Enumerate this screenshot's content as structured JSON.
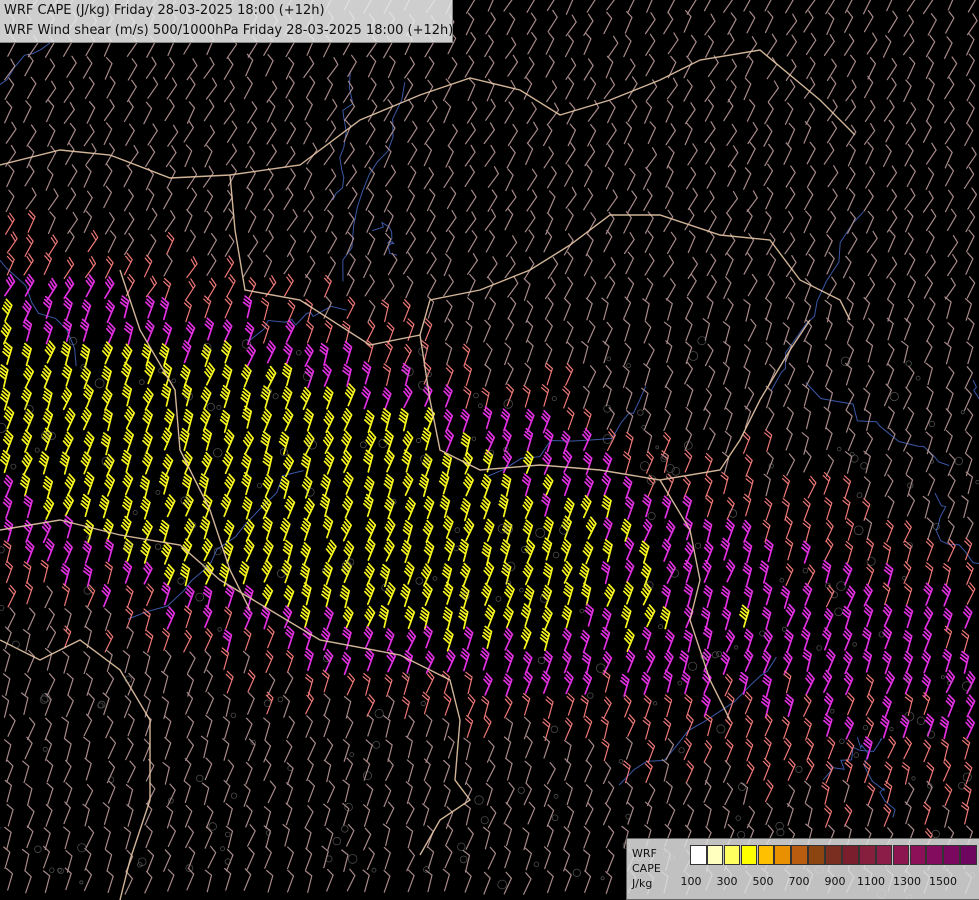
{
  "header": {
    "line1": "WRF CAPE (J/kg) Friday 28-03-2025 18:00 (+12h)",
    "line2": "WRF Wind shear (m/s) 500/1000hPa Friday 28-03-2025 18:00 (+12h)"
  },
  "legend": {
    "labels": [
      "WRF",
      "CAPE",
      "J/kg"
    ],
    "colors": [
      "#ffffff",
      "#ffffc0",
      "#ffff60",
      "#ffff00",
      "#ffc000",
      "#e89000",
      "#b85c10",
      "#8c4410",
      "#7a2e20",
      "#7a1e2e",
      "#861e3e",
      "#8c1c48",
      "#8e1650",
      "#8c1058",
      "#840c5e",
      "#7a085e",
      "#6e0660"
    ],
    "ticks": [
      "100",
      "300",
      "500",
      "700",
      "900",
      "1100",
      "1300",
      "1500"
    ]
  },
  "map": {
    "barb_colors": {
      "weak": "#a88a8a",
      "moderate": "#f07878",
      "strong": "#e030e0",
      "very_strong": "#f8f820"
    },
    "border_color": "#e8c8a8",
    "river_color": "#4a6ed0"
  }
}
